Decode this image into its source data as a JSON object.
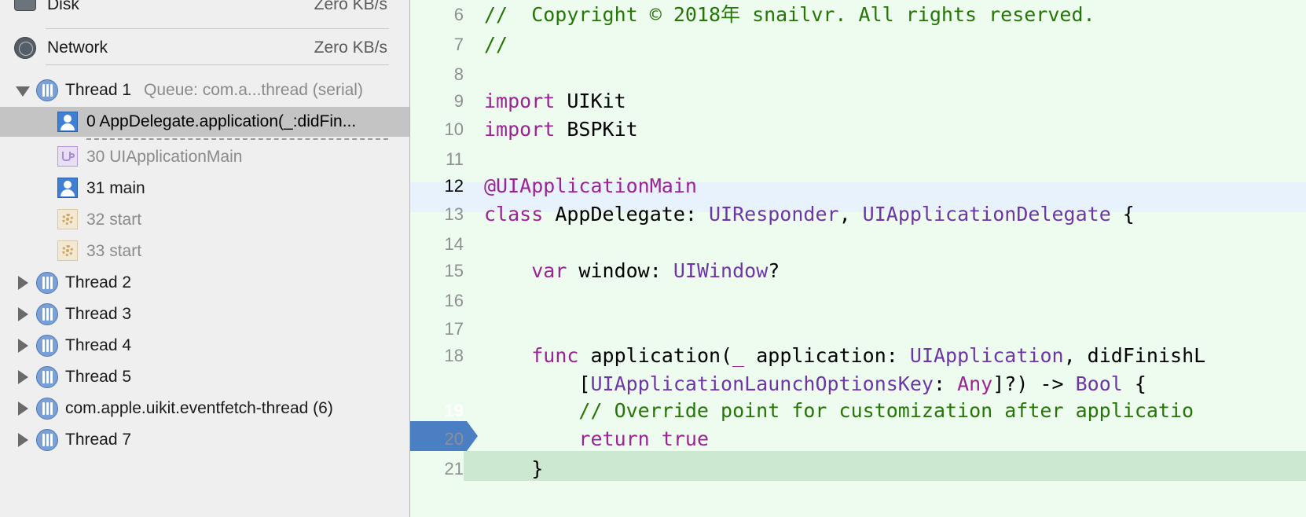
{
  "sidebar": {
    "gauges": [
      {
        "label": "Disk",
        "value": "Zero KB/s"
      },
      {
        "label": "Network",
        "value": "Zero KB/s"
      }
    ],
    "thread1": {
      "name": "Thread 1",
      "queue": "Queue: com.a...thread (serial)"
    },
    "frames": [
      {
        "label": "0 AppDelegate.application(_:didFin...",
        "icon": "user-icon"
      },
      {
        "label": "30 UIApplicationMain",
        "icon": "framework-icon"
      },
      {
        "label": "31 main",
        "icon": "user-icon"
      },
      {
        "label": "32 start",
        "icon": "system-icon"
      },
      {
        "label": "33 start",
        "icon": "system-icon"
      }
    ],
    "threads": [
      {
        "label": "Thread 2"
      },
      {
        "label": "Thread 3"
      },
      {
        "label": "Thread 4"
      },
      {
        "label": "Thread 5"
      },
      {
        "label": "com.apple.uikit.eventfetch-thread (6)"
      },
      {
        "label": "Thread 7"
      }
    ]
  },
  "editor": {
    "current_line": "19",
    "lines": [
      {
        "num": "6",
        "segments": [
          {
            "t": "//  Copyright © 2018年 snailvr. All rights reserved.",
            "c": "cm"
          }
        ]
      },
      {
        "num": "7",
        "segments": [
          {
            "t": "//",
            "c": "cm"
          }
        ]
      },
      {
        "num": "8",
        "segments": []
      },
      {
        "num": "9",
        "segments": [
          {
            "t": "import",
            "c": "kw"
          },
          {
            "t": " UIKit",
            "c": ""
          }
        ]
      },
      {
        "num": "10",
        "segments": [
          {
            "t": "import",
            "c": "kw"
          },
          {
            "t": " BSPKit",
            "c": ""
          }
        ]
      },
      {
        "num": "11",
        "segments": []
      },
      {
        "num": "12",
        "segments": [
          {
            "t": "@UIApplicationMain",
            "c": "attr"
          }
        ]
      },
      {
        "num": "13",
        "segments": [
          {
            "t": "class",
            "c": "kw"
          },
          {
            "t": " AppDelegate: ",
            "c": ""
          },
          {
            "t": "UIResponder",
            "c": "ty"
          },
          {
            "t": ", ",
            "c": ""
          },
          {
            "t": "UIApplicationDelegate",
            "c": "ty"
          },
          {
            "t": " {",
            "c": ""
          }
        ]
      },
      {
        "num": "14",
        "segments": []
      },
      {
        "num": "15",
        "segments": [
          {
            "t": "    ",
            "c": ""
          },
          {
            "t": "var",
            "c": "kw"
          },
          {
            "t": " window: ",
            "c": ""
          },
          {
            "t": "UIWindow",
            "c": "ty"
          },
          {
            "t": "?",
            "c": ""
          }
        ]
      },
      {
        "num": "16",
        "segments": []
      },
      {
        "num": "17",
        "segments": []
      },
      {
        "num": "18",
        "segments": [
          {
            "t": "    ",
            "c": ""
          },
          {
            "t": "func",
            "c": "kw"
          },
          {
            "t": " application(",
            "c": ""
          },
          {
            "t": "_",
            "c": "kw"
          },
          {
            "t": " application: ",
            "c": ""
          },
          {
            "t": "UIApplication",
            "c": "ty"
          },
          {
            "t": ", didFinishL",
            "c": ""
          }
        ]
      },
      {
        "num": "",
        "segments": [
          {
            "t": "        [",
            "c": ""
          },
          {
            "t": "UIApplicationLaunchOptionsKey",
            "c": "ty"
          },
          {
            "t": ": ",
            "c": ""
          },
          {
            "t": "Any",
            "c": "kw"
          },
          {
            "t": "]?) -> ",
            "c": ""
          },
          {
            "t": "Bool",
            "c": "ty"
          },
          {
            "t": " {",
            "c": ""
          }
        ]
      },
      {
        "num": "19",
        "segments": [
          {
            "t": "        // Override point for customization after applicatio",
            "c": "cm"
          }
        ]
      },
      {
        "num": "20",
        "segments": [
          {
            "t": "        ",
            "c": ""
          },
          {
            "t": "return",
            "c": "kw"
          },
          {
            "t": " ",
            "c": ""
          },
          {
            "t": "true",
            "c": "kw"
          }
        ]
      },
      {
        "num": "21",
        "segments": [
          {
            "t": "    }",
            "c": ""
          }
        ]
      }
    ]
  }
}
